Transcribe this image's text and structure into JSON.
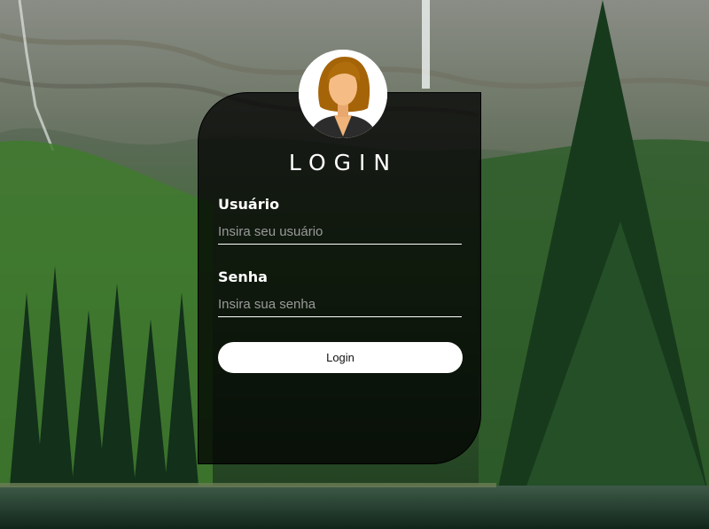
{
  "login": {
    "title": "LOGIN",
    "username_label": "Usuário",
    "username_placeholder": "Insira seu usuário",
    "username_value": "",
    "password_label": "Senha",
    "password_placeholder": "Insira sua senha",
    "password_value": "",
    "button_label": "Login"
  },
  "icons": {
    "avatar": "female-user-avatar-icon"
  },
  "colors": {
    "card_background": "#000000",
    "text": "#ffffff",
    "placeholder": "#9a9a9a",
    "button_background": "#ffffff",
    "button_text": "#111111"
  }
}
